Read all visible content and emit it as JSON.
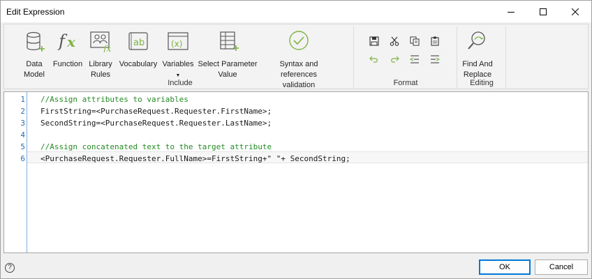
{
  "window": {
    "title": "Edit Expression"
  },
  "ribbon": {
    "include": {
      "label": "Include",
      "buttons": {
        "data_model": "Data\nModel",
        "function": "Function",
        "library_rules": "Library\nRules",
        "vocabulary": "Vocabulary",
        "variables": "Variables",
        "variables_caret": "▼",
        "select_parameter_value": "Select Parameter\nValue",
        "syntax_validation": "Syntax and references\nvalidation"
      }
    },
    "format": {
      "label": "Format"
    },
    "editing": {
      "label": "Editing",
      "find_and_replace": "Find And\nReplace"
    },
    "colors": {
      "accent_green": "#7cb342",
      "icon_gray": "#555555",
      "icon_blue": "#2b6cb0"
    }
  },
  "editor": {
    "line_numbers": [
      "1",
      "2",
      "3",
      "4",
      "5",
      "6"
    ],
    "lines": [
      "//Assign attributes to variables",
      "FirstString=<PurchaseRequest.Requester.FirstName>;",
      "SecondString=<PurchaseRequest.Requester.LastName>;",
      "",
      "//Assign concatenated text to the target attribute",
      "<PurchaseRequest.Requester.FullName>=FirstString+\" \"+ SecondString;"
    ],
    "comment_color": "#238b23"
  },
  "footer": {
    "help_glyph": "?",
    "ok_label": "OK",
    "cancel_label": "Cancel"
  }
}
